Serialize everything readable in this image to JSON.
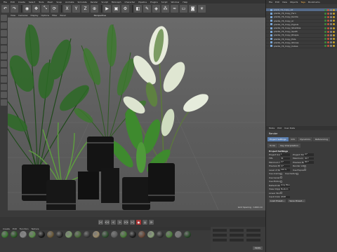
{
  "menubar": {
    "items": [
      "File",
      "Edit",
      "Create",
      "Select",
      "Tools",
      "Mesh",
      "Snap",
      "Animate",
      "Simulate",
      "Render",
      "Sculpt",
      "MoGraph",
      "Character",
      "Pipeline",
      "Plugins",
      "Script",
      "Window",
      "Help"
    ]
  },
  "viewport": {
    "menu": [
      "View",
      "Cameras",
      "Display",
      "Options",
      "Filter",
      "Panel"
    ],
    "name": "Perspective",
    "footer": "Grid Spacing : 1000 cm"
  },
  "object_manager": {
    "tabs": [
      "File",
      "Edit",
      "View",
      "Objects",
      "Tags",
      "Bookmarks"
    ],
    "active_tab": "Tags",
    "objects": [
      "plant_74_Copy_All",
      "plants_74_Copy_Fern",
      "plants_74_Copy_Kentia",
      "plants_74_Copy_Ar",
      "plants_74_Copy_Dypsis",
      "plants_74_Copy_Strelitzia",
      "plants_74_Copy_Spath",
      "plants_74_Copy_Rhapis",
      "plants_74_Copy_Pots",
      "plants_74_Copy_Stones",
      "plants_74_Copy_Cubes"
    ],
    "tag_colors": [
      "#3a8a3a",
      "#c4553a",
      "#888888",
      "#c9a227"
    ]
  },
  "attribute_manager": {
    "menu": [
      "Mode",
      "Edit",
      "User Data"
    ],
    "title": "Render",
    "tabs": [
      "Project Settings",
      "Info",
      "Dynamics",
      "Referencing"
    ],
    "tabs_row2": [
      "To Do",
      "Key Interpolation"
    ],
    "section": "Project Settings",
    "fields": [
      {
        "label": "Project Scale",
        "value": "1"
      },
      {
        "label": "FPS",
        "value": "30"
      },
      {
        "label": "Minimum Time",
        "value": "0 F"
      },
      {
        "label": "Preview Min Time",
        "value": "0 F"
      },
      {
        "label": "Level of Detail",
        "value": "100 %"
      },
      {
        "label": "Use Animation",
        "value": ""
      },
      {
        "label": "Use Generators",
        "value": ""
      },
      {
        "label": "Use Motion System",
        "value": ""
      },
      {
        "label": "Default Object Color",
        "value": "Gray Blue"
      },
      {
        "label": "View Clipping",
        "value": "Medium"
      },
      {
        "label": "Linear Workflow",
        "value": ""
      },
      {
        "label": "Input Color Profile",
        "value": "sRGB"
      }
    ],
    "fields_right": [
      {
        "label": "Project Time",
        "value": "0 F"
      },
      {
        "label": "Maximum Time",
        "value": "90 F"
      },
      {
        "label": "Preview Max Time",
        "value": "90 F"
      },
      {
        "label": "Render LOD in Editor",
        "value": ""
      },
      {
        "label": "Use Expressions",
        "value": ""
      },
      {
        "label": "Use Deformers",
        "value": ""
      }
    ],
    "buttons": [
      "Load Preset...",
      "Save Preset..."
    ]
  },
  "material_manager": {
    "menu": [
      "Create",
      "Edit",
      "Function",
      "Texture"
    ],
    "swatches": [
      "#3d7a35",
      "#2e5c28",
      "#888888",
      "#5a8a4a",
      "#1a1a1a",
      "#6b5a3a",
      "#2a2a2a",
      "#7a9a6a",
      "#4a6a3a",
      "#3a3a3a",
      "#9a8a6a",
      "#2f4f2f",
      "#5f5f5f",
      "#4a7a3a",
      "#1f1f1f",
      "#6a4a3a",
      "#8aa07a",
      "#333333",
      "#4f7f3f",
      "#777777",
      "#2a4a2a"
    ]
  },
  "coordinates": {
    "apply": "Apply"
  },
  "transport": {
    "buttons": [
      "|<",
      "<<",
      "<",
      ">",
      ">>",
      ">|",
      "●",
      "◎",
      "⟳"
    ]
  }
}
